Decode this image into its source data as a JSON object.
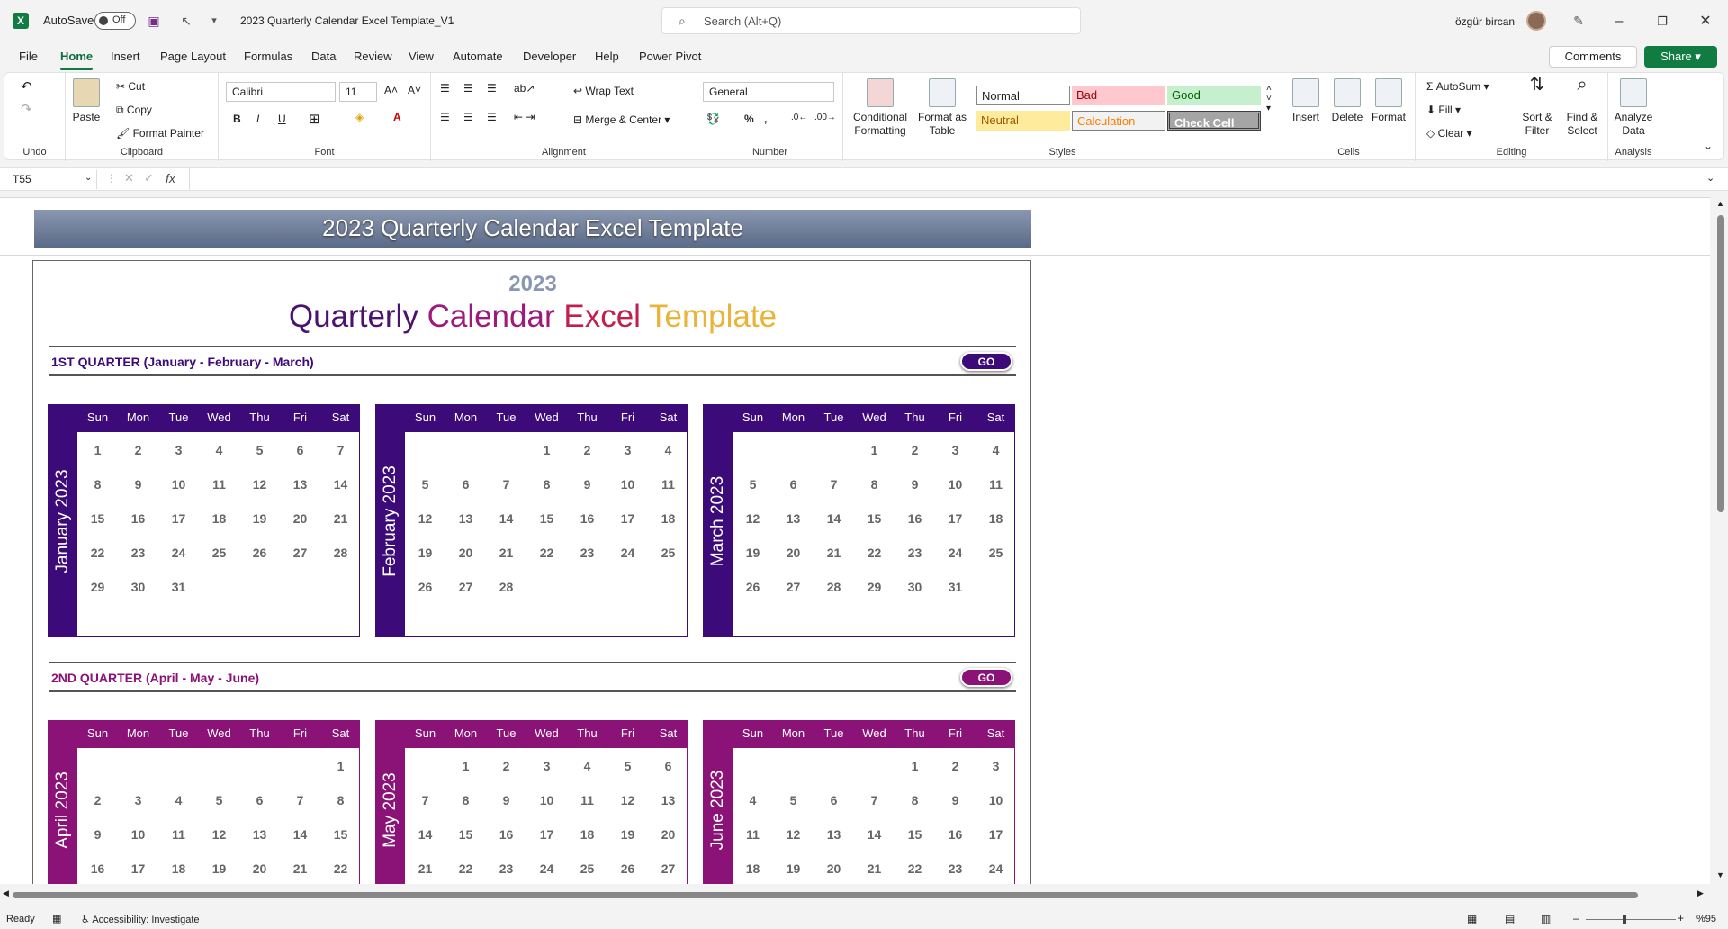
{
  "titlebar": {
    "autosave_label": "AutoSave",
    "autosave_state": "Off",
    "document_title": "2023 Quarterly Calendar Excel Template_V1",
    "search_placeholder": "Search (Alt+Q)",
    "username": "özgür bircan"
  },
  "menu": {
    "tabs": [
      "File",
      "Home",
      "Insert",
      "Page Layout",
      "Formulas",
      "Data",
      "Review",
      "View",
      "Automate",
      "Developer",
      "Help",
      "Power Pivot"
    ],
    "active": "Home",
    "comments_label": "Comments",
    "share_label": "Share"
  },
  "ribbon": {
    "undo_group": "Undo",
    "clipboard": {
      "paste": "Paste",
      "cut": "Cut",
      "copy": "Copy",
      "format_painter": "Format Painter",
      "group": "Clipboard"
    },
    "font": {
      "name": "Calibri",
      "size": "11",
      "group": "Font"
    },
    "alignment": {
      "wrap_text": "Wrap Text",
      "merge_center": "Merge & Center",
      "group": "Alignment"
    },
    "number": {
      "format": "General",
      "group": "Number"
    },
    "styles": {
      "conditional_formatting": "Conditional Formatting",
      "format_as_table": "Format as Table",
      "normal": "Normal",
      "bad": "Bad",
      "good": "Good",
      "neutral": "Neutral",
      "calculation": "Calculation",
      "check_cell": "Check Cell",
      "group": "Styles"
    },
    "cells": {
      "insert": "Insert",
      "delete": "Delete",
      "format": "Format",
      "group": "Cells"
    },
    "editing": {
      "autosum": "AutoSum",
      "fill": "Fill",
      "clear": "Clear",
      "sort_filter": "Sort & Filter",
      "find_select": "Find & Select",
      "group": "Editing"
    },
    "analysis": {
      "analyze_data": "Analyze Data",
      "group": "Analysis"
    }
  },
  "formula_bar": {
    "name_box": "T55",
    "fx": "fx",
    "content": ""
  },
  "sheet": {
    "banner": "2023 Quarterly Calendar Excel Template",
    "year": "2023",
    "subtitle_words": [
      "Quarterly",
      "Calendar",
      "Excel",
      "Template"
    ],
    "quarters": [
      {
        "title": "1ST QUARTER (January - February - March)",
        "go": "GO"
      },
      {
        "title": "2ND QUARTER (April - May - June)",
        "go": "GO"
      }
    ],
    "weekdays": [
      "Sun",
      "Mon",
      "Tue",
      "Wed",
      "Thu",
      "Fri",
      "Sat"
    ],
    "months": [
      {
        "name": "January 2023",
        "start": 0,
        "days": 31,
        "visible_rows": 5
      },
      {
        "name": "February 2023",
        "start": 3,
        "days": 28,
        "visible_rows": 5
      },
      {
        "name": "March 2023",
        "start": 3,
        "days": 31,
        "visible_rows": 5
      },
      {
        "name": "April 2023",
        "start": 6,
        "days": 22,
        "visible_rows": 4
      },
      {
        "name": "May 2023",
        "start": 1,
        "days": 27,
        "visible_rows": 4
      },
      {
        "name": "June 2023",
        "start": 4,
        "days": 24,
        "visible_rows": 4
      }
    ]
  },
  "colors": {
    "q1": "#3d0a7a",
    "q2": "#8b1276",
    "quarterly": "#4b1270",
    "calendar": "#9c1a7c",
    "excel": "#c21f4f",
    "template": "#e8b43a",
    "banner_text": "#ffffff"
  },
  "status": {
    "ready": "Ready",
    "accessibility": "Accessibility: Investigate",
    "zoom": "%95"
  }
}
